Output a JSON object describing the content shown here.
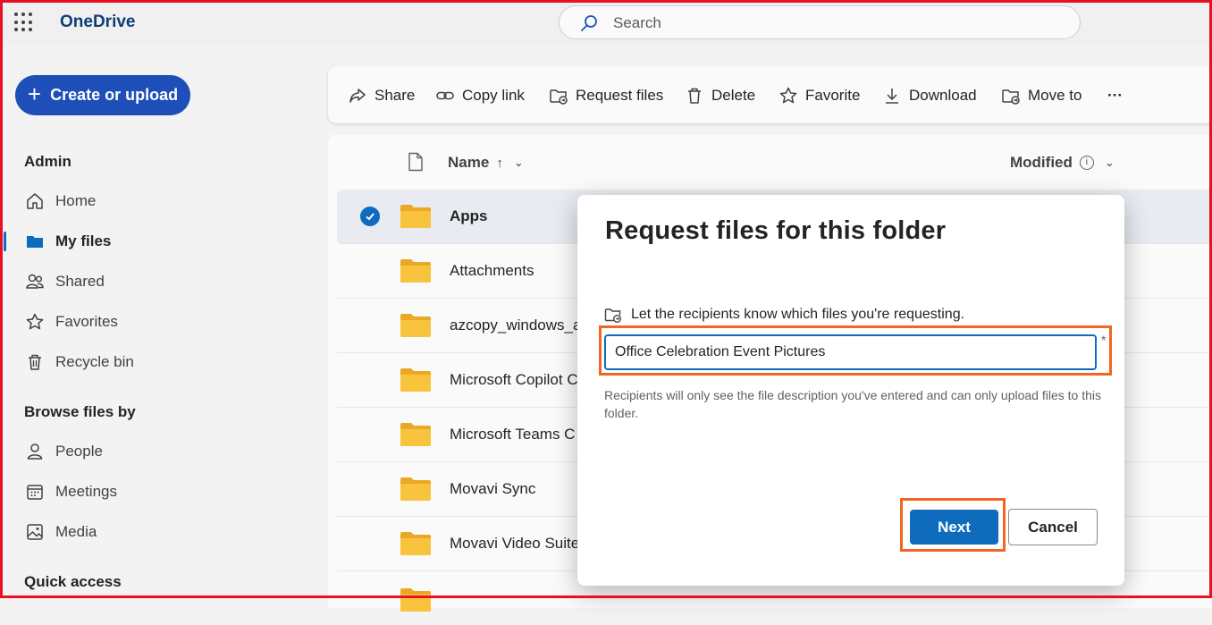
{
  "app": {
    "title": "OneDrive"
  },
  "search": {
    "placeholder": "Search"
  },
  "nav": {
    "create_label": "Create or upload",
    "sections": {
      "admin": "Admin",
      "browse": "Browse files by",
      "quick": "Quick access"
    },
    "items": {
      "home": "Home",
      "my_files": "My files",
      "shared": "Shared",
      "favorites": "Favorites",
      "recycle": "Recycle bin",
      "people": "People",
      "meetings": "Meetings",
      "media": "Media"
    }
  },
  "toolbar": {
    "share": "Share",
    "copy_link": "Copy link",
    "request_files": "Request files",
    "delete": "Delete",
    "favorite": "Favorite",
    "download": "Download",
    "move_to": "Move to",
    "more": "···"
  },
  "list": {
    "columns": {
      "name": "Name",
      "modified": "Modified"
    },
    "rows": [
      "Apps",
      "Attachments",
      "azcopy_windows_a",
      "Microsoft Copilot C",
      "Microsoft Teams C",
      "Movavi Sync",
      "Movavi Video Suite"
    ]
  },
  "dialog": {
    "title": "Request files for this folder",
    "label": "Let the recipients know which files you're requesting.",
    "input_value": "Office Celebration Event Pictures",
    "required_mark": "*",
    "helper": "Recipients will only see the file description you've entered and can only upload files to this folder.",
    "next_label": "Next",
    "cancel_label": "Cancel"
  },
  "colors": {
    "accent": "#0f6cbd",
    "create_button": "#1e4fb8",
    "highlight": "#f26522",
    "frame": "#e81123",
    "folder": "#f8c43d"
  }
}
